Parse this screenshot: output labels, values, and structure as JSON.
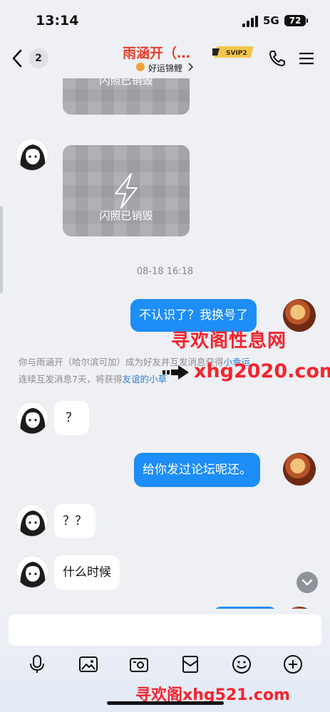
{
  "status_bar": {
    "time": "13:14",
    "network": "5G",
    "battery": "72"
  },
  "header": {
    "unread_count": "2",
    "contact_name": "雨涵开（…",
    "contact_sub": "好运锦鲤",
    "vip_badge": "SVIP2"
  },
  "messages": {
    "flash_label_1": "闪照已销毁",
    "flash_label_2": "闪照已销毁",
    "timestamp": "08-18 16:18",
    "out_1": "不认识了？我换号了",
    "system_line_1_pre": "你与雨涵开（哈尔滨可加）成为好友并互发消息获得",
    "system_line_1_link": "小幸运",
    "system_line_2_pre": "连续互发消息7天，将获得",
    "system_line_2_link": "友谊的小草",
    "in_1": "？",
    "out_2": "给你发过论坛呢还。",
    "in_2": "？？",
    "in_3": "什么时候"
  },
  "watermarks": {
    "title": "寻欢阁性息网",
    "url": "xhg2020.com",
    "bottom": "寻欢阁xhg521.com"
  },
  "toolbar": {
    "icons": [
      "microphone-icon",
      "image-icon",
      "camera-icon",
      "red-packet-icon",
      "emoji-icon",
      "plus-icon"
    ]
  },
  "colors": {
    "accent_blue": "#1d8df7",
    "name_red": "#e8402c",
    "watermark_red": "#f5232d",
    "background": "#eef0f4"
  }
}
